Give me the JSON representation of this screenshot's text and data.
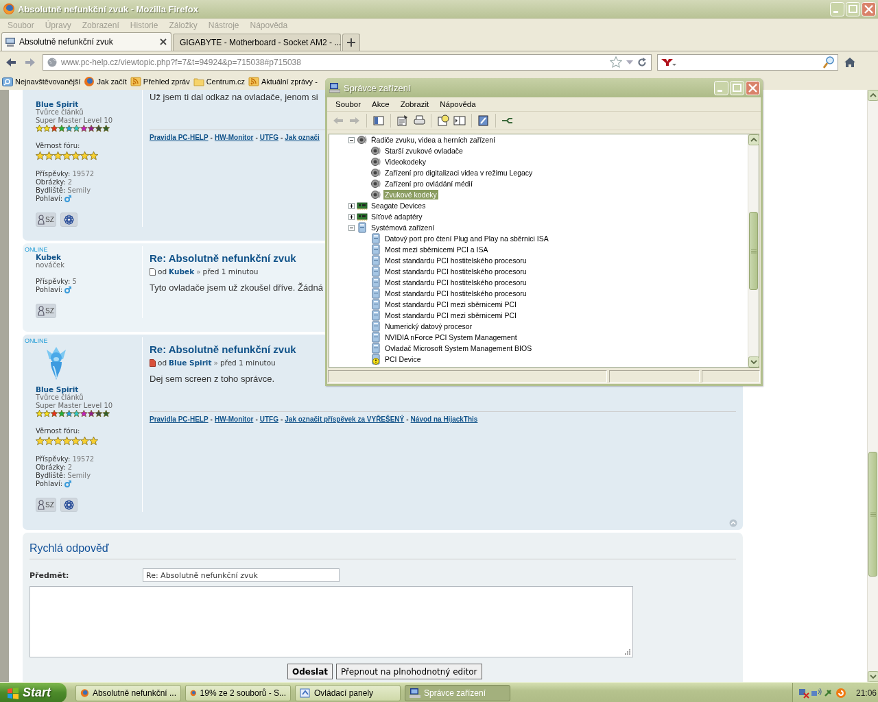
{
  "browser": {
    "title": "Absolutně nefunkční zvuk - Mozilla Firefox",
    "menu": [
      "Soubor",
      "Úpravy",
      "Zobrazení",
      "Historie",
      "Záložky",
      "Nástroje",
      "Nápověda"
    ],
    "tabs": [
      {
        "label": "Absolutně nefunkční zvuk",
        "selected": true
      },
      {
        "label": "GIGABYTE - Motherboard - Socket AM2 - ...",
        "selected": false
      }
    ],
    "url": "www.pc-help.cz/viewtopic.php?f=7&t=94924&p=715038#p715038",
    "bookmarks": [
      {
        "label": "Nejnavštěvovanější",
        "kind": "search"
      },
      {
        "label": "Jak začít",
        "kind": "globe"
      },
      {
        "label": "Přehled zpráv",
        "kind": "feed"
      },
      {
        "label": "Centrum.cz",
        "kind": "folder"
      },
      {
        "label": "Aktuální zprávy -",
        "kind": "feed"
      }
    ]
  },
  "posts": [
    {
      "author": "Blue Spirit",
      "rank": "Tvůrce článků",
      "level": "Super Master Level 10",
      "loyalty": {
        "label": "Věrnost fóru:",
        "stars": 7
      },
      "stats": [
        {
          "label": "Příspěvky:",
          "value": "19572"
        },
        {
          "label": "Obrázky:",
          "value": "2"
        },
        {
          "label": "Bydliště:",
          "value": "Semily"
        },
        {
          "label": "Pohlaví:",
          "kind": "male"
        }
      ],
      "contact": [
        {
          "kind": "message",
          "label": "SZ"
        },
        {
          "kind": "flower"
        }
      ],
      "body": "Už jsem ti dal odkaz na ovladače, jenom si",
      "links": [
        {
          "kind": "link",
          "text": "Pravidla PC-HELP"
        },
        {
          "kind": "sep",
          "text": "-"
        },
        {
          "kind": "link",
          "text": "HW-Monitor"
        },
        {
          "kind": "sep",
          "text": "-"
        },
        {
          "kind": "link",
          "text": "UTFG"
        },
        {
          "kind": "sep",
          "text": "-"
        },
        {
          "kind": "link",
          "text": "Jak označi"
        }
      ]
    },
    {
      "online": "ONLINE",
      "author": "Kubek",
      "rank": "nováček",
      "stats": [
        {
          "label": "Příspěvky:",
          "value": "5"
        },
        {
          "label": "Pohlaví:",
          "kind": "male"
        }
      ],
      "contact": [
        {
          "kind": "message",
          "label": "SZ"
        }
      ],
      "title": "Re: Absolutně nefunkční zvuk",
      "meta": {
        "prefix": "od",
        "author": "Kubek",
        "separator": "»",
        "time": "před 1 minutou",
        "unread": false
      },
      "body": "Tyto ovladače jsem už zkoušel dříve. Žádná"
    },
    {
      "online": "ONLINE",
      "avatar": {
        "kind": "picture"
      },
      "author": "Blue Spirit",
      "rank": "Tvůrce článků",
      "level": "Super Master Level 10",
      "loyalty": {
        "label": "Věrnost fóru:",
        "stars": 7
      },
      "stats": [
        {
          "label": "Příspěvky:",
          "value": "19572"
        },
        {
          "label": "Obrázky:",
          "value": "2"
        },
        {
          "label": "Bydliště:",
          "value": "Semily"
        },
        {
          "label": "Pohlaví:",
          "kind": "male"
        }
      ],
      "contact": [
        {
          "kind": "message",
          "label": "SZ"
        },
        {
          "kind": "flower"
        }
      ],
      "title": "Re: Absolutně nefunkční zvuk",
      "meta": {
        "prefix": "od",
        "author": "Blue Spirit",
        "separator": "»",
        "time": "před 1 minutou",
        "unread": true
      },
      "body": "Dej sem screen z toho správce.",
      "links": [
        {
          "kind": "link",
          "text": "Pravidla PC-HELP"
        },
        {
          "kind": "sep",
          "text": "-"
        },
        {
          "kind": "link",
          "text": "HW-Monitor"
        },
        {
          "kind": "sep",
          "text": "-"
        },
        {
          "kind": "link",
          "text": "UTFG"
        },
        {
          "kind": "sep",
          "text": "-"
        },
        {
          "kind": "link",
          "text": "Jak označit příspěvek za VYŘEŠENÝ"
        },
        {
          "kind": "sep",
          "text": "-"
        },
        {
          "kind": "link",
          "text": "Návod na HijackThis"
        }
      ]
    }
  ],
  "quick_reply": {
    "title": "Rychlá odpověď",
    "subject_label": "Předmět:",
    "subject": "Re: Absolutně nefunkční zvuk",
    "buttons": [
      {
        "label": "Odeslat",
        "kind": "primary"
      },
      {
        "label": "Přepnout na plnohodnotný editor",
        "kind": "secondary"
      }
    ]
  },
  "device_manager": {
    "title": "Správce zařízení",
    "menu": [
      "Soubor",
      "Akce",
      "Zobrazit",
      "Nápověda"
    ],
    "tree": [
      {
        "label": "Řadiče zvuku, videa a herních zařízení",
        "kind": "sound",
        "expanded": true,
        "selected": false,
        "children": [
          {
            "label": "Starší zvukové ovladače",
            "kind": "sound",
            "selected": false
          },
          {
            "label": "Videokodeky",
            "kind": "sound",
            "selected": false
          },
          {
            "label": "Zařízení pro digitalizaci videa v režimu Legacy",
            "kind": "sound",
            "selected": false
          },
          {
            "label": "Zařízení pro ovládání médií",
            "kind": "sound",
            "selected": false
          },
          {
            "label": "Zvukové kodeky",
            "kind": "sound",
            "selected": true
          }
        ]
      },
      {
        "label": "Seagate Devices",
        "kind": "card",
        "expanded": false,
        "selected": false
      },
      {
        "label": "Síťové adaptéry",
        "kind": "card",
        "expanded": false,
        "selected": false
      },
      {
        "label": "Systémová zařízení",
        "kind": "system",
        "expanded": true,
        "selected": false,
        "children": [
          {
            "label": "Datový port pro čtení Plug and Play na sběrnici ISA",
            "kind": "system",
            "selected": false
          },
          {
            "label": "Most mezi sběrnicemi PCI a ISA",
            "kind": "system",
            "selected": false
          },
          {
            "label": "Most standardu PCI hostitelského procesoru",
            "kind": "system",
            "selected": false
          },
          {
            "label": "Most standardu PCI hostitelského procesoru",
            "kind": "system",
            "selected": false
          },
          {
            "label": "Most standardu PCI hostitelského procesoru",
            "kind": "system",
            "selected": false
          },
          {
            "label": "Most standardu PCI hostitelského procesoru",
            "kind": "system",
            "selected": false
          },
          {
            "label": "Most standardu PCI mezi sběrnicemi PCI",
            "kind": "system",
            "selected": false
          },
          {
            "label": "Most standardu PCI mezi sběrnicemi PCI",
            "kind": "system",
            "selected": false
          },
          {
            "label": "Numerický datový procesor",
            "kind": "system",
            "selected": false
          },
          {
            "label": "NVIDIA nForce PCI System Management",
            "kind": "system",
            "selected": false
          },
          {
            "label": "Ovladač Microsoft System Management BIOS",
            "kind": "system",
            "selected": false
          },
          {
            "label": "PCI Device",
            "kind": "warning",
            "selected": false
          }
        ]
      }
    ]
  },
  "taskbar": {
    "start": "Start",
    "tasks": [
      {
        "label": "Absolutně nefunkční ...",
        "kind": "browser",
        "selected": false
      },
      {
        "label": "19% ze 2 souborů - S...",
        "kind": "browser",
        "selected": false
      },
      {
        "label": "Ovládací panely",
        "kind": "panel",
        "selected": false
      },
      {
        "label": "Správce zařízení",
        "kind": "computer",
        "selected": true
      }
    ],
    "time": "21:06"
  }
}
